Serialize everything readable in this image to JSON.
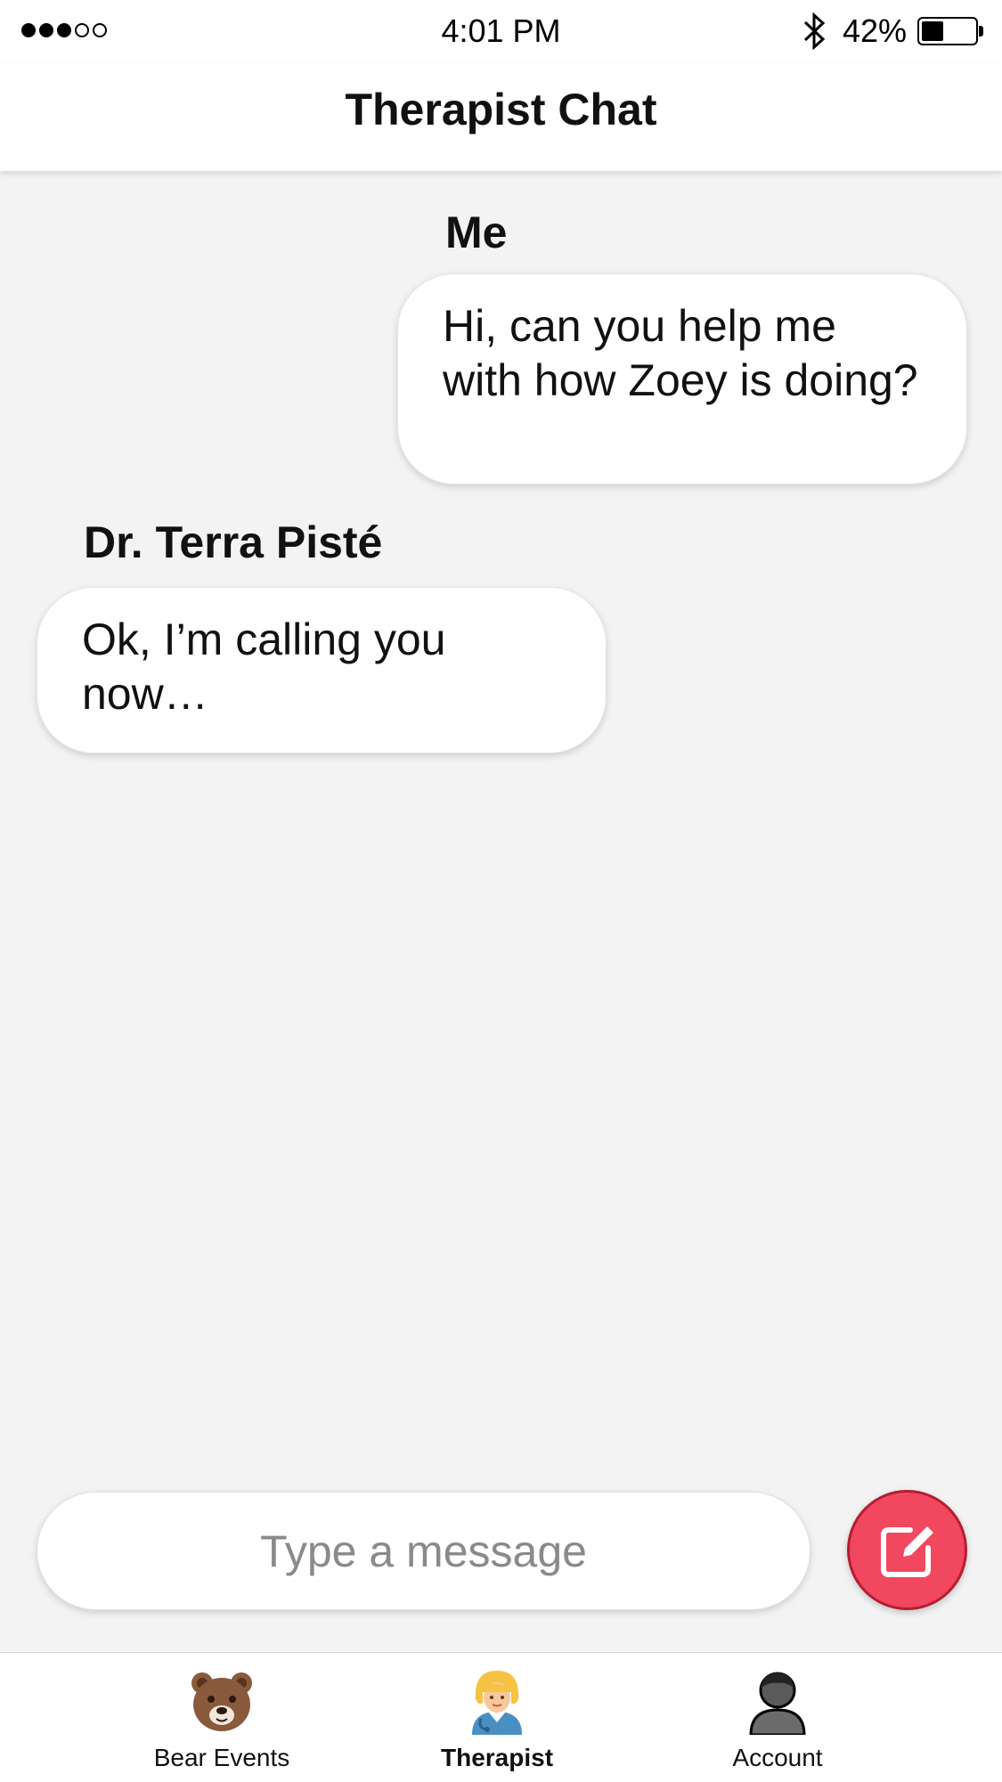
{
  "status_bar": {
    "signal_filled": 3,
    "signal_total": 5,
    "time": "4:01 PM",
    "battery_percent": "42%",
    "battery_level": 0.42
  },
  "header": {
    "title": "Therapist Chat"
  },
  "messages": [
    {
      "sender": "Me",
      "text": "Hi, can you help me with how Zoey is doing?"
    },
    {
      "sender": "Dr. Terra Pisté",
      "text": "Ok, I’m calling you now…"
    }
  ],
  "composer": {
    "placeholder": "Type a message"
  },
  "tabs": [
    {
      "label": "Bear Events",
      "icon": "bear-face-icon",
      "active": false
    },
    {
      "label": "Therapist",
      "icon": "health-worker-icon",
      "active": true
    },
    {
      "label": "Account",
      "icon": "person-silhouette-icon",
      "active": false
    }
  ],
  "colors": {
    "accent": "#f2485f",
    "background": "#f3f3f3"
  }
}
